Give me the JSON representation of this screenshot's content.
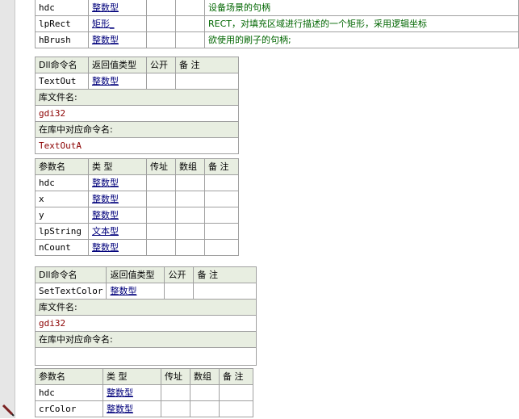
{
  "top_params": [
    {
      "name": "hdc",
      "type": "整数型",
      "note": "设备场景的句柄"
    },
    {
      "name": "lpRect",
      "type": "矩形_",
      "note": "RECT，对填充区域进行描述的一个矩形，采用逻辑坐标"
    },
    {
      "name": "hBrush",
      "type": "整数型",
      "note": "欲使用的刷子的句柄;"
    }
  ],
  "headers": {
    "dll_cmd": "Dll命令名",
    "ret_type": "返回值类型",
    "public": "公开",
    "remark": "备 注",
    "lib_file": "库文件名:",
    "lib_cmd": "在库中对应命令名:",
    "param_name": "参数名",
    "param_type": "类 型",
    "by_ref": "传址",
    "array": "数组"
  },
  "dll1": {
    "name": "TextOut",
    "ret_type": "整数型",
    "lib": "gdi32",
    "lib_cmd": "TextOutA",
    "params": [
      {
        "name": "hdc",
        "type": "整数型"
      },
      {
        "name": "x",
        "type": "整数型"
      },
      {
        "name": "y",
        "type": "整数型"
      },
      {
        "name": "lpString",
        "type": "文本型"
      },
      {
        "name": "nCount",
        "type": "整数型"
      }
    ]
  },
  "dll2": {
    "name": "SetTextColor",
    "ret_type": "整数型",
    "lib": "gdi32",
    "lib_cmd": "",
    "params": [
      {
        "name": "hdc",
        "type": "整数型"
      },
      {
        "name": "crColor",
        "type": "整数型"
      }
    ]
  }
}
